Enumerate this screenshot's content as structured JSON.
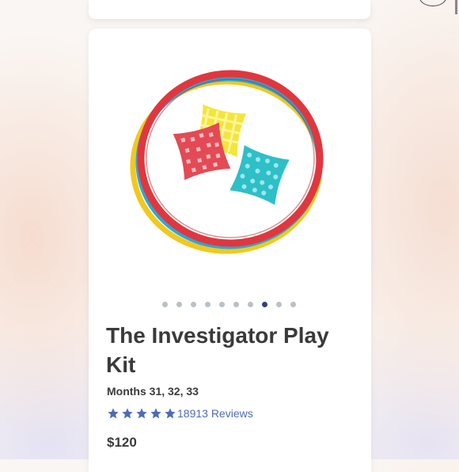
{
  "product": {
    "title": "The Investigator Play Kit",
    "months": "Months 31, 32, 33",
    "rating": 5,
    "reviews": "18913 Reviews",
    "price": "$120",
    "image_icon": "rings-and-beanbags-illustration"
  },
  "carousel": {
    "total": 10,
    "active_index": 7
  },
  "colors": {
    "title_text": "#3a3a3a",
    "star": "#4e6bb5",
    "review_link": "#4e6bb5",
    "active_dot": "#2f3f86",
    "inactive_dot": "#b9c0c8",
    "ring_red": "#e0373f",
    "ring_blue": "#2aa8d8",
    "ring_yellow": "#f2c81e"
  }
}
